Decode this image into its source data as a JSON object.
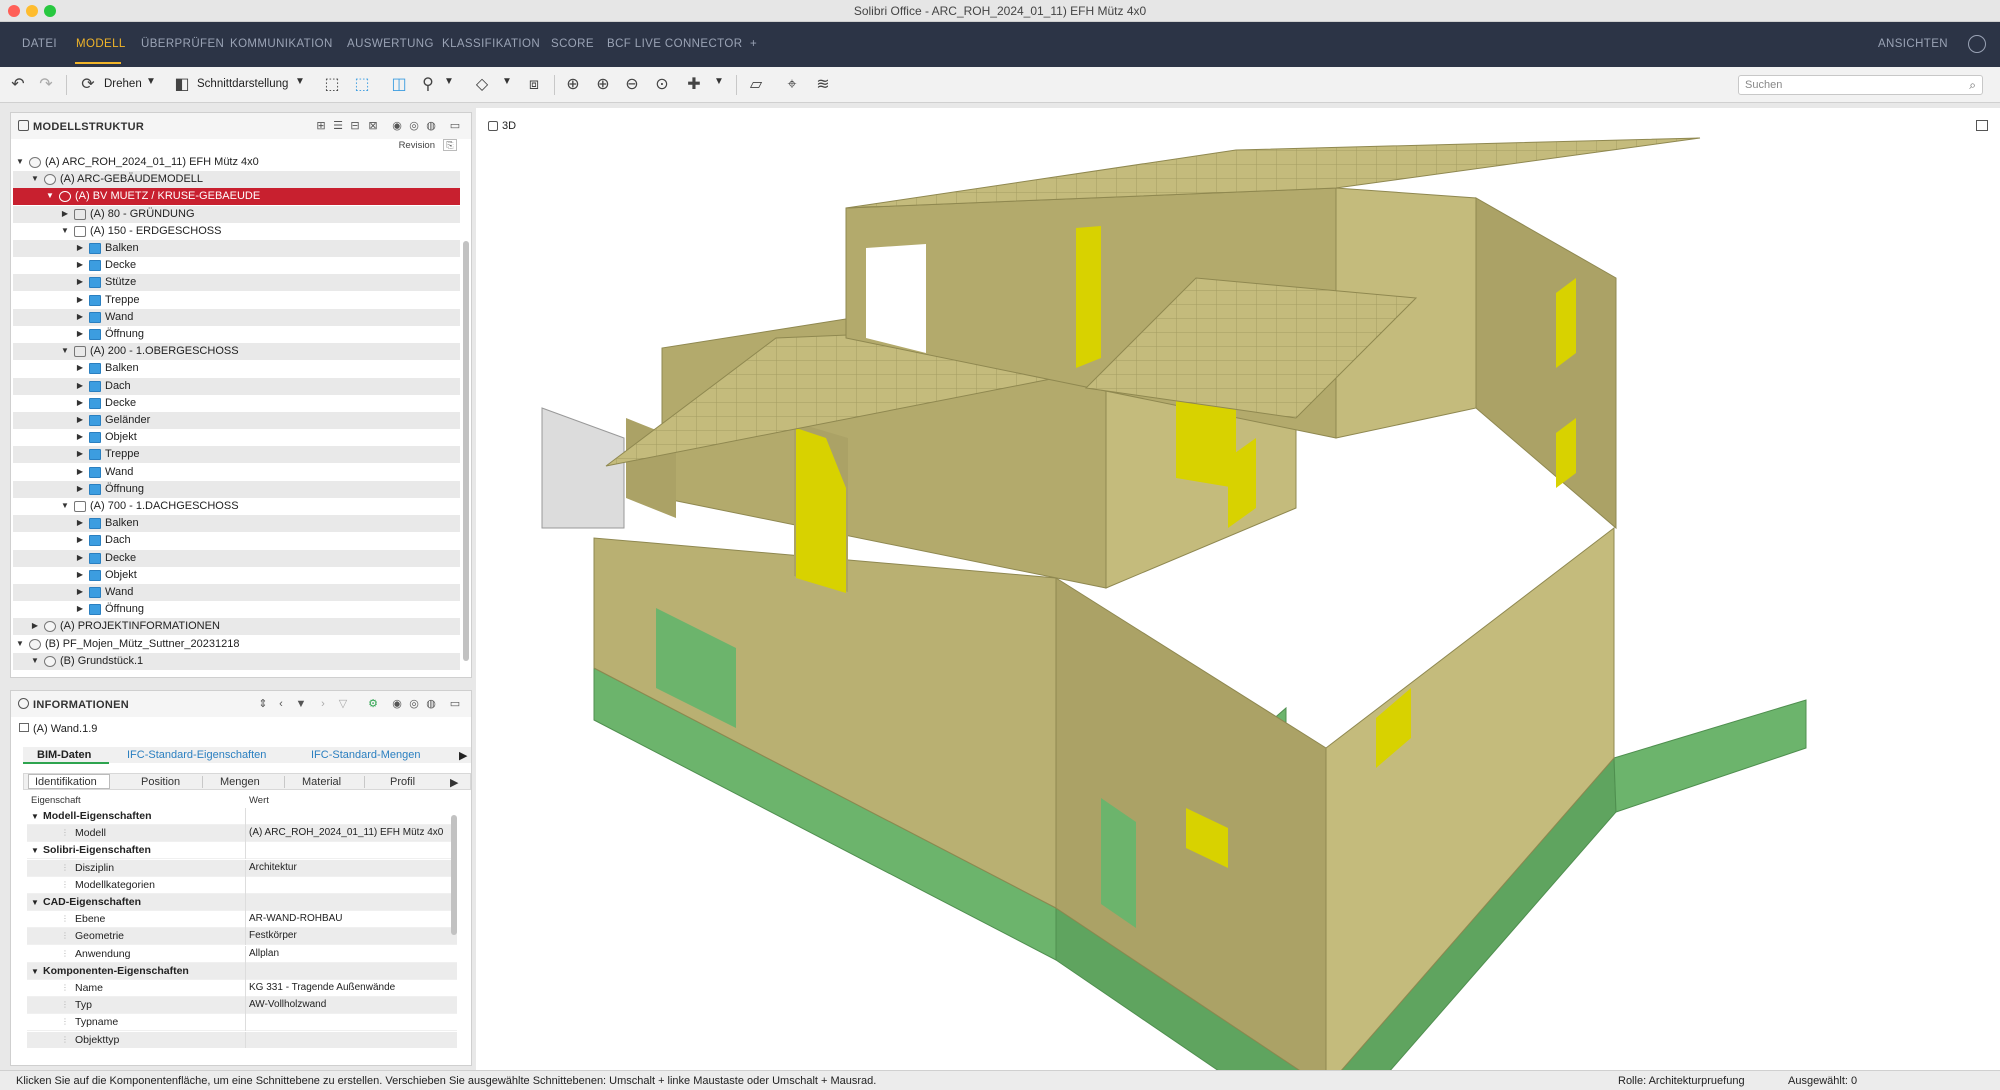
{
  "window": {
    "title": "Solibri Office - ARC_ROH_2024_01_11) EFH Mütz 4x0"
  },
  "menu": {
    "items": [
      "DATEI",
      "MODELL",
      "ÜBERPRÜFEN",
      "KOMMUNIKATION",
      "AUSWERTUNG",
      "KLASSIFIKATION",
      "SCORE",
      "BCF LIVE CONNECTOR",
      "+"
    ],
    "active": "MODELL",
    "right": "ANSICHTEN"
  },
  "toolbar": {
    "rotate_label": "Drehen",
    "section_label": "Schnittdarstellung",
    "search_placeholder": "Suchen"
  },
  "model_tree": {
    "title": "MODELLSTRUKTUR",
    "revision_label": "Revision",
    "rows": [
      {
        "text": "(A) ARC_ROH_2024_01_11) EFH Mütz 4x0",
        "caret": "▼",
        "icon": "model"
      },
      {
        "text": "(A) ARC-GEBÄUDEMODELL",
        "caret": "▼",
        "icon": "model"
      },
      {
        "text": "(A) BV MUETZ / KRUSE-GEBAEUDE",
        "caret": "▼",
        "icon": "model"
      },
      {
        "text": "(A) 80 - GRÜNDUNG",
        "caret": "▶",
        "icon": "level"
      },
      {
        "text": "(A) 150 - ERDGESCHOSS",
        "caret": "▼",
        "icon": "level"
      },
      {
        "text": "Balken",
        "caret": "▶",
        "icon": "folder"
      },
      {
        "text": "Decke",
        "caret": "▶",
        "icon": "folder"
      },
      {
        "text": "Stütze",
        "caret": "▶",
        "icon": "folder"
      },
      {
        "text": "Treppe",
        "caret": "▶",
        "icon": "folder"
      },
      {
        "text": "Wand",
        "caret": "▶",
        "icon": "folder"
      },
      {
        "text": "Öffnung",
        "caret": "▶",
        "icon": "folder"
      },
      {
        "text": "(A) 200 - 1.OBERGESCHOSS",
        "caret": "▼",
        "icon": "level"
      },
      {
        "text": "Balken",
        "caret": "▶",
        "icon": "folder"
      },
      {
        "text": "Dach",
        "caret": "▶",
        "icon": "folder"
      },
      {
        "text": "Decke",
        "caret": "▶",
        "icon": "folder"
      },
      {
        "text": "Geländer",
        "caret": "▶",
        "icon": "folder"
      },
      {
        "text": "Objekt",
        "caret": "▶",
        "icon": "folder"
      },
      {
        "text": "Treppe",
        "caret": "▶",
        "icon": "folder"
      },
      {
        "text": "Wand",
        "caret": "▶",
        "icon": "folder"
      },
      {
        "text": "Öffnung",
        "caret": "▶",
        "icon": "folder"
      },
      {
        "text": "(A) 700 - 1.DACHGESCHOSS",
        "caret": "▼",
        "icon": "level"
      },
      {
        "text": "Balken",
        "caret": "▶",
        "icon": "folder"
      },
      {
        "text": "Dach",
        "caret": "▶",
        "icon": "folder"
      },
      {
        "text": "Decke",
        "caret": "▶",
        "icon": "folder"
      },
      {
        "text": "Objekt",
        "caret": "▶",
        "icon": "folder"
      },
      {
        "text": "Wand",
        "caret": "▶",
        "icon": "folder"
      },
      {
        "text": "Öffnung",
        "caret": "▶",
        "icon": "folder"
      },
      {
        "text": "(A) PROJEKTINFORMATIONEN",
        "caret": "▶",
        "icon": "model"
      },
      {
        "text": "(B) PF_Mojen_Mütz_Suttner_20231218",
        "caret": "▼",
        "icon": "model"
      },
      {
        "text": "(B) Grundstück.1",
        "caret": "▼",
        "icon": "model"
      }
    ],
    "selected_index": 2,
    "selected_color": "#c8202f"
  },
  "info": {
    "title": "INFORMATIONEN",
    "selected_object": "(A) Wand.1.9",
    "tabs": [
      "BIM-Daten",
      "IFC-Standard-Eigenschaften",
      "IFC-Standard-Mengen"
    ],
    "subtabs": [
      "Identifikation",
      "Position",
      "Mengen",
      "Material",
      "Profil"
    ],
    "col_property": "Eigenschaft",
    "col_value": "Wert",
    "rows": [
      {
        "key": "Modell-Eigenschaften",
        "value": "",
        "group": true
      },
      {
        "key": "Modell",
        "value": "(A) ARC_ROH_2024_01_11) EFH Mütz 4x0",
        "group": false
      },
      {
        "key": "Solibri-Eigenschaften",
        "value": "",
        "group": true
      },
      {
        "key": "Disziplin",
        "value": "Architektur",
        "group": false
      },
      {
        "key": "Modellkategorien",
        "value": "",
        "group": false
      },
      {
        "key": "CAD-Eigenschaften",
        "value": "",
        "group": true
      },
      {
        "key": "Ebene",
        "value": "AR-WAND-ROHBAU",
        "group": false
      },
      {
        "key": "Geometrie",
        "value": "Festkörper",
        "group": false
      },
      {
        "key": "Anwendung",
        "value": "Allplan",
        "group": false
      },
      {
        "key": "Komponenten-Eigenschaften",
        "value": "",
        "group": true
      },
      {
        "key": "Name",
        "value": "KG 331 - Tragende Außenwände",
        "group": false
      },
      {
        "key": "Typ",
        "value": "AW-Vollholzwand",
        "group": false
      },
      {
        "key": "Typname",
        "value": "",
        "group": false
      },
      {
        "key": "Objekttyp",
        "value": "",
        "group": false
      }
    ]
  },
  "viewport": {
    "label": "3D"
  },
  "status": {
    "hint": "Klicken Sie auf die Komponentenfläche, um eine Schnittebene zu erstellen. Verschieben Sie ausgewählte Schnittebenen: Umschalt + linke Maustaste oder Umschalt + Mausrad.",
    "role": "Rolle: Architekturpruefung",
    "selected": "Ausgewählt: 0"
  },
  "colors": {
    "menu_bg": "#2c3446",
    "accent": "#f0b429",
    "wall": "#b9b072",
    "foundation": "#6cb46c",
    "glass": "#d8d200"
  }
}
